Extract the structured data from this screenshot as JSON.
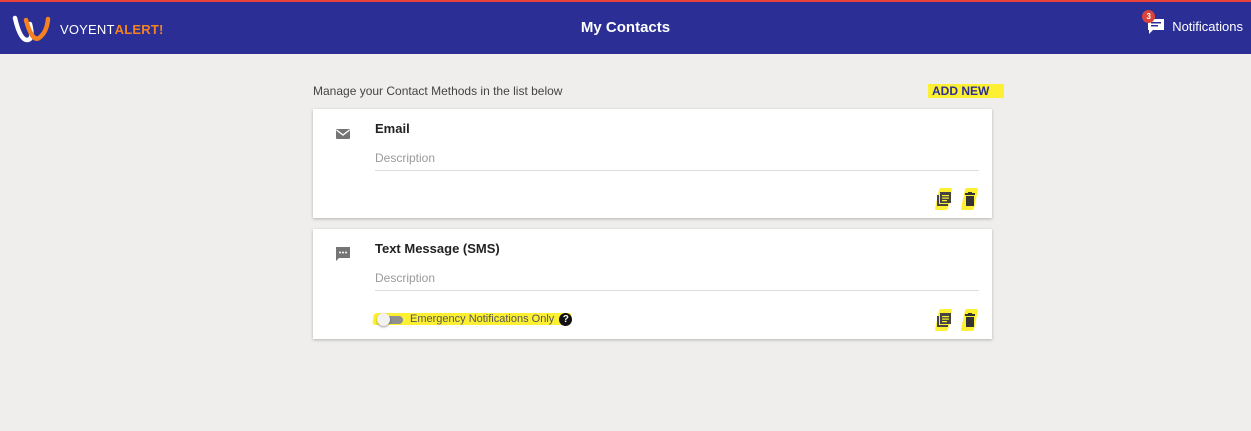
{
  "header": {
    "brand_main": "VOYENT",
    "brand_accent": "ALERT!",
    "page_title": "My Contacts",
    "notifications_label": "Notifications",
    "notifications_count": "3"
  },
  "main": {
    "intro": "Manage your Contact Methods in the list below",
    "add_new_label": "ADD NEW"
  },
  "contacts": [
    {
      "icon": "mail-icon",
      "title": "Email",
      "description_placeholder": "Description"
    },
    {
      "icon": "sms-icon",
      "title": "Text Message (SMS)",
      "description_placeholder": "Description",
      "emergency_label": "Emergency Notifications Only",
      "emergency_enabled": false,
      "help_glyph": "?"
    }
  ],
  "colors": {
    "header_bg": "#2b2e94",
    "header_border": "#e7433c",
    "accent_orange": "#f6821f",
    "highlight": "#fdf032"
  }
}
